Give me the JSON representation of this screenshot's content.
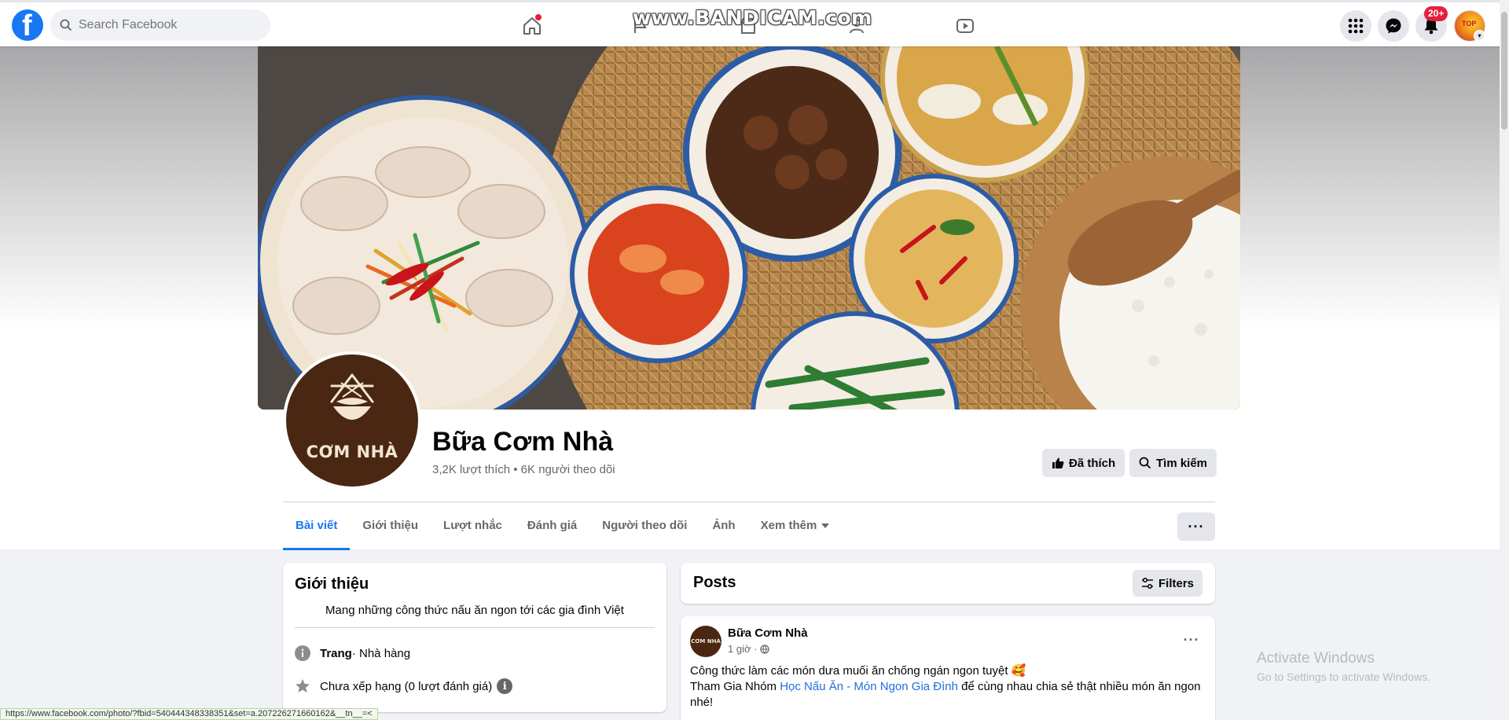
{
  "topbar": {
    "logo_letter": "f",
    "search_placeholder": "Search Facebook",
    "watermark": "www.BANDICAM.com",
    "notification_count": "20+",
    "avatar_text": "TOP"
  },
  "page": {
    "name": "Bữa Cơm Nhà",
    "stats": "3,2K lượt thích • 6K người theo dõi",
    "profile_brand": "CƠM NHÀ",
    "liked_label": "Đã thích",
    "search_label": "Tìm kiếm",
    "more_label": "···"
  },
  "tabs": [
    {
      "label": "Bài viết",
      "active": true
    },
    {
      "label": "Giới thiệu"
    },
    {
      "label": "Lượt nhắc"
    },
    {
      "label": "Đánh giá"
    },
    {
      "label": "Người theo dõi"
    },
    {
      "label": "Ảnh"
    },
    {
      "label": "Xem thêm"
    }
  ],
  "intro": {
    "title": "Giới thiệu",
    "bio": "Mang những công thức nấu ăn ngon tới các gia đình Việt",
    "category_bold": "Trang",
    "category_rest": " · Nhà hàng",
    "rating": "Chưa xếp hạng (0 lượt đánh giá)",
    "info_mark": "i"
  },
  "posts": {
    "title": "Posts",
    "filters_label": "Filters"
  },
  "post": {
    "avatar_text": "CƠM NHÀ",
    "author": "Bữa Cơm Nhà",
    "time": "1 giờ ·",
    "menu_label": "···",
    "line1": "Công thức làm các món dưa muối ăn chống ngán ngon tuyệt 🥰",
    "line2_prefix": "Tham Gia Nhóm ",
    "line2_link": "Học Nấu Ăn - Món Ngon Gia Đình",
    "line2_suffix": " để cùng nhau chia sẻ thật nhiều món ăn ngon",
    "line3": "nhé!"
  },
  "windows": {
    "activate_title": "Activate Windows",
    "activate_subtitle": "Go to Settings to activate Windows."
  },
  "status_bar": {
    "url": "https://www.facebook.com/photo/?fbid=540444348338351&set=a.207226271660162&__tn__=<"
  },
  "colors": {
    "brand_blue": "#1877f2",
    "badge_red": "#e41e3f",
    "profile_brown": "#4a2712"
  }
}
